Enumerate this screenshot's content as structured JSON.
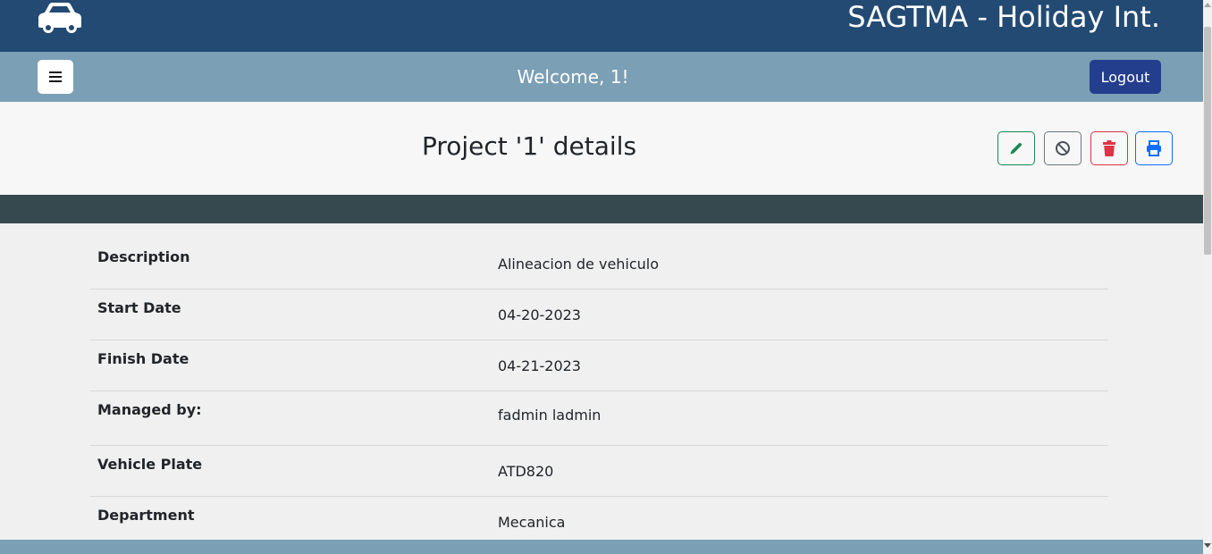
{
  "header": {
    "app_title": "SAGTMA - Holiday Int.",
    "logo_icon": "car-icon"
  },
  "navbar": {
    "menu_icon": "hamburger-menu-icon",
    "welcome": "Welcome, 1!",
    "logout_label": "Logout"
  },
  "page": {
    "title": "Project '1' details",
    "actions": [
      {
        "icon": "pencil-icon",
        "color": "#198754"
      },
      {
        "icon": "ban-icon",
        "color": "#6c757d"
      },
      {
        "icon": "trash-icon",
        "color": "#dc3545"
      },
      {
        "icon": "printer-icon",
        "color": "#0d6efd"
      }
    ]
  },
  "details": [
    {
      "label": "Description",
      "value": "Alineacion de vehiculo"
    },
    {
      "label": "Start Date",
      "value": "04-20-2023"
    },
    {
      "label": "Finish Date",
      "value": "04-21-2023"
    },
    {
      "label": "Managed by:",
      "value": "fadmin ladmin"
    },
    {
      "label": "Vehicle Plate",
      "value": "ATD820"
    },
    {
      "label": "Department",
      "value": "Mecanica"
    }
  ],
  "colors": {
    "topbar": "#234a72",
    "navbar": "#7b9fb5",
    "logout_button": "#243e8e",
    "dark_band": "#35494f"
  }
}
